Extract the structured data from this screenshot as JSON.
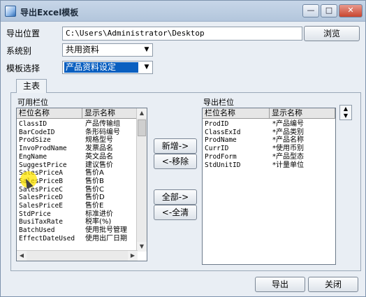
{
  "window": {
    "title": "导出Excel模板",
    "min_symbol": "—",
    "max_symbol": "□",
    "close_symbol": "✕"
  },
  "form": {
    "export_path_label": "导出位置",
    "export_path_value": "C:\\Users\\Administrator\\Desktop",
    "browse_label": "浏览",
    "system_label": "系统别",
    "system_value": "共用资料",
    "template_label": "模板选择",
    "template_value": "产品资料设定"
  },
  "tab": {
    "main_label": "主表"
  },
  "available": {
    "title": "可用栏位",
    "col1": "栏位名称",
    "col2": "显示名称",
    "rows": [
      {
        "field": "ClassID",
        "display": "产品传输组"
      },
      {
        "field": "BarCodeID",
        "display": "条形码编号"
      },
      {
        "field": "ProdSize",
        "display": "规格型号"
      },
      {
        "field": "InvoProdName",
        "display": "发票品名"
      },
      {
        "field": "EngName",
        "display": "英文品名"
      },
      {
        "field": "SuggestPrice",
        "display": "建议售价"
      },
      {
        "field": "SalesPriceA",
        "display": "售价A"
      },
      {
        "field": "SalesPriceB",
        "display": "售价B"
      },
      {
        "field": "SalesPriceC",
        "display": "售价C"
      },
      {
        "field": "SalesPriceD",
        "display": "售价D"
      },
      {
        "field": "SalesPriceE",
        "display": "售价E"
      },
      {
        "field": "StdPrice",
        "display": "标准进价"
      },
      {
        "field": "BusiTaxRate",
        "display": "税率(%)"
      },
      {
        "field": "BatchUsed",
        "display": "使用批号管理"
      },
      {
        "field": "EffectDateUsed",
        "display": "使用出厂日期"
      }
    ]
  },
  "buttons": {
    "add": "新增->",
    "remove": "<-移除",
    "all_add": "全部->",
    "all_clear": "<-全清",
    "export": "导出",
    "close": "关闭"
  },
  "export": {
    "title": "导出栏位",
    "col1": "栏位名称",
    "col2": "显示名称",
    "rows": [
      {
        "field": "ProdID",
        "display": "*产品编号"
      },
      {
        "field": "ClassExId",
        "display": "*产品类别"
      },
      {
        "field": "ProdName",
        "display": "*产品名称"
      },
      {
        "field": "CurrID",
        "display": "*使用币别"
      },
      {
        "field": "ProdForm",
        "display": "*产品型态"
      },
      {
        "field": "StdUnitID",
        "display": "*计量单位"
      }
    ]
  },
  "icons": {
    "combo_arrow": "▼",
    "scroll_up": "▲",
    "scroll_down": "▼",
    "scroll_left": "◀",
    "scroll_right": "▶",
    "spin_up": "▲",
    "spin_down": "▼"
  }
}
